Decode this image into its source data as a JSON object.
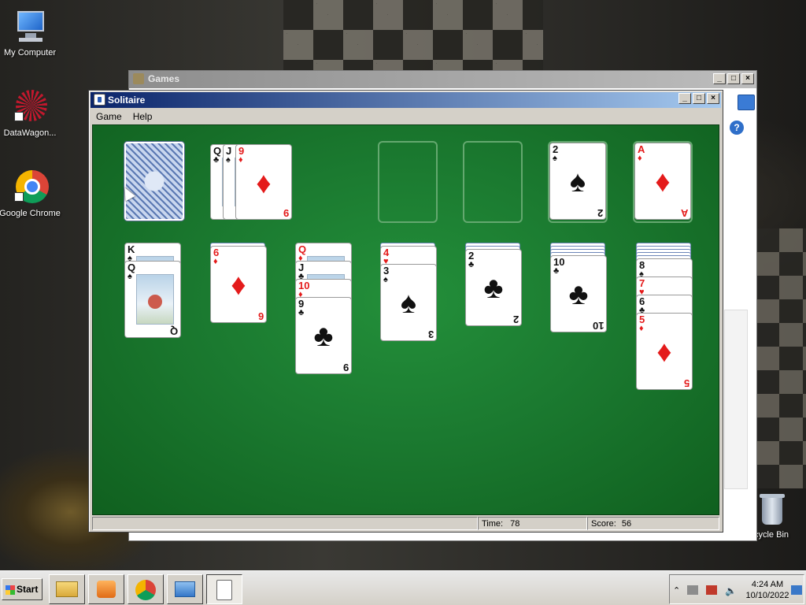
{
  "desktop": {
    "icons": [
      {
        "label": "My Computer",
        "icon": "computer-icon"
      },
      {
        "label": "DataWagon...",
        "icon": "datawagon-icon"
      },
      {
        "label": "Google Chrome",
        "icon": "chrome-icon"
      },
      {
        "label": "cycle Bin",
        "icon": "recycle-bin-icon"
      }
    ]
  },
  "games_window": {
    "title": "Games",
    "help_label": "?"
  },
  "solitaire": {
    "title": "Solitaire",
    "menu": [
      "Game",
      "Help"
    ],
    "status": {
      "time_label": "Time:",
      "time_value": "78",
      "score_label": "Score:",
      "score_value": "56"
    },
    "stock": {
      "face": "down"
    },
    "waste": [
      {
        "rank": "Q",
        "suit": "♣",
        "color": "black"
      },
      {
        "rank": "J",
        "suit": "♠",
        "color": "black"
      },
      {
        "rank": "9",
        "suit": "♦",
        "color": "red"
      }
    ],
    "foundations": [
      {
        "rank": "",
        "suit": ""
      },
      {
        "rank": "",
        "suit": ""
      },
      {
        "rank": "2",
        "suit": "♠",
        "color": "black"
      },
      {
        "rank": "A",
        "suit": "♦",
        "color": "red"
      }
    ],
    "tableau": [
      {
        "hidden": 0,
        "cards": [
          {
            "rank": "K",
            "suit": "♠",
            "color": "black"
          },
          {
            "rank": "Q",
            "suit": "♠",
            "color": "black"
          }
        ]
      },
      {
        "hidden": 1,
        "cards": [
          {
            "rank": "6",
            "suit": "♦",
            "color": "red"
          }
        ]
      },
      {
        "hidden": 0,
        "cards": [
          {
            "rank": "Q",
            "suit": "♦",
            "color": "red"
          },
          {
            "rank": "J",
            "suit": "♣",
            "color": "black"
          },
          {
            "rank": "10",
            "suit": "♦",
            "color": "red"
          },
          {
            "rank": "9",
            "suit": "♣",
            "color": "black"
          }
        ]
      },
      {
        "hidden": 1,
        "cards": [
          {
            "rank": "4",
            "suit": "♥",
            "color": "red"
          },
          {
            "rank": "3",
            "suit": "♠",
            "color": "black"
          }
        ]
      },
      {
        "hidden": 2,
        "cards": [
          {
            "rank": "2",
            "suit": "♣",
            "color": "black"
          }
        ]
      },
      {
        "hidden": 4,
        "cards": [
          {
            "rank": "10",
            "suit": "♣",
            "color": "black"
          }
        ]
      },
      {
        "hidden": 5,
        "cards": [
          {
            "rank": "8",
            "suit": "♠",
            "color": "black"
          },
          {
            "rank": "7",
            "suit": "♥",
            "color": "red"
          },
          {
            "rank": "6",
            "suit": "♣",
            "color": "black"
          },
          {
            "rank": "5",
            "suit": "♦",
            "color": "red"
          }
        ]
      }
    ]
  },
  "taskbar": {
    "start_label": "Start",
    "buttons": [
      "explorer-icon",
      "media-player-icon",
      "chrome-icon",
      "control-panel-icon",
      "solitaire-icon"
    ],
    "tray": {
      "time": "4:24 AM",
      "date": "10/10/2022"
    }
  }
}
